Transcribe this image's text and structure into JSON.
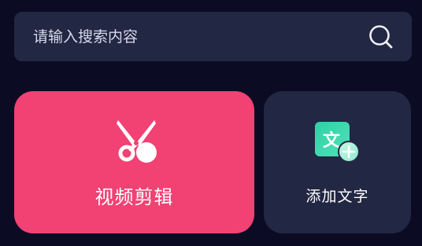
{
  "search": {
    "placeholder": "请输入搜索内容",
    "icon": "search-icon"
  },
  "cards": {
    "video_edit": {
      "label": "视频剪辑",
      "icon": "scissors-icon",
      "color": "#f24173"
    },
    "add_text": {
      "label": "添加文字",
      "icon": "add-text-icon",
      "icon_glyph": "文",
      "color": "#222743"
    }
  },
  "colors": {
    "background": "#0b0c24",
    "surface": "#222743",
    "accent": "#f24173",
    "teal": "#35d3a2"
  }
}
